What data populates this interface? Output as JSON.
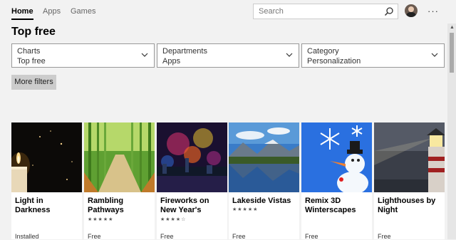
{
  "nav": {
    "items": [
      "Home",
      "Apps",
      "Games"
    ],
    "active": "Home"
  },
  "search": {
    "placeholder": "Search"
  },
  "page": {
    "title": "Top free"
  },
  "filters": [
    {
      "label": "Charts",
      "value": "Top free"
    },
    {
      "label": "Departments",
      "value": "Apps"
    },
    {
      "label": "Category",
      "value": "Personalization"
    }
  ],
  "more_filters_label": "More filters",
  "cards": [
    {
      "name": "Light in Darkness",
      "stars": "",
      "price": "Installed"
    },
    {
      "name": "Rambling Pathways",
      "stars": "★★★★★",
      "price": "Free"
    },
    {
      "name": "Fireworks on New Year's",
      "stars": "★★★★☆",
      "price": "Free"
    },
    {
      "name": "Lakeside Vistas",
      "stars": "★★★★★",
      "price": "Free"
    },
    {
      "name": "Remix 3D Winterscapes",
      "stars": "",
      "price": "Free"
    },
    {
      "name": "Lighthouses by Night",
      "stars": "",
      "price": "Free"
    }
  ],
  "icons": {
    "search": "search-icon",
    "more": "more-options-icon",
    "chevron": "chevron-down-icon"
  }
}
